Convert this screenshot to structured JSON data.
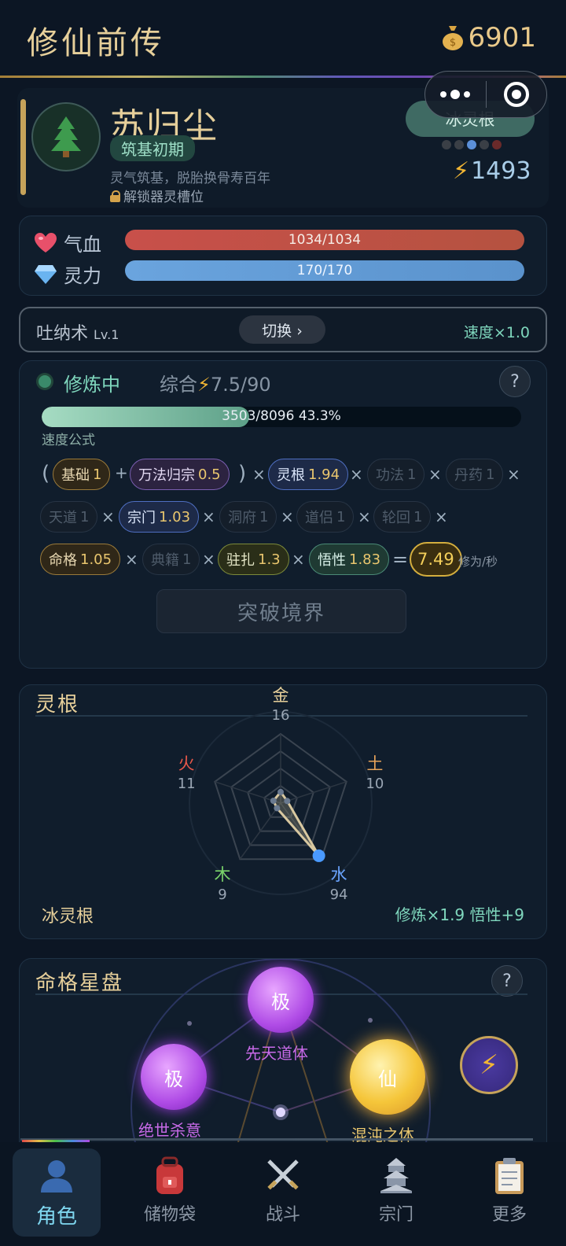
{
  "header": {
    "title": "修仙前传",
    "coin_icon": "money-bag-icon",
    "coins": "6901"
  },
  "character": {
    "avatar_icon": "tree-icon",
    "name": "苏归尘",
    "realm": "筑基初期",
    "description": "灵气筑基，脱胎换骨寿百年",
    "unlock_text": "解锁器灵槽位",
    "spirit_root_button": "冰灵根",
    "power": "1493",
    "dot_colors": [
      "#3a3f46",
      "#3a3f46",
      "#5b8fd8",
      "#3a3f46",
      "#6a2a2a"
    ]
  },
  "vitals": {
    "hp_label": "气血",
    "hp_value": "1034/1034",
    "hp_fraction": 1.0,
    "mp_label": "灵力",
    "mp_value": "170/170",
    "mp_fraction": 1.0
  },
  "technique": {
    "name": "吐纳术",
    "level": "Lv.1",
    "switch_label": "切换 ›",
    "speed": "速度×1.0"
  },
  "cultivation": {
    "status": "修炼中",
    "total_label": "综合",
    "total_value": "7.5/90",
    "help": "?",
    "progress_text": "3503/8096  43.3%",
    "progress_fraction": 0.433,
    "formula_label": "速度公式",
    "chips": [
      {
        "label": "基础",
        "value": "1"
      },
      {
        "label": "万法归宗",
        "value": "0.5"
      },
      {
        "label": "灵根",
        "value": "1.94"
      },
      {
        "label": "功法",
        "value": "1"
      },
      {
        "label": "丹药",
        "value": "1"
      },
      {
        "label": "天道",
        "value": "1"
      },
      {
        "label": "宗门",
        "value": "1.03"
      },
      {
        "label": "洞府",
        "value": "1"
      },
      {
        "label": "道侣",
        "value": "1"
      },
      {
        "label": "轮回",
        "value": "1"
      },
      {
        "label": "命格",
        "value": "1.05"
      },
      {
        "label": "典籍",
        "value": "1"
      },
      {
        "label": "驻扎",
        "value": "1.3"
      },
      {
        "label": "悟性",
        "value": "1.83"
      }
    ],
    "ops": {
      "open": "(",
      "close": ")",
      "plus": "+",
      "times": "×",
      "equals": "="
    },
    "result": "7.49",
    "result_unit": "修为/秒",
    "breakthrough_label": "突破境界"
  },
  "spirit_root": {
    "title": "灵根",
    "elements": [
      {
        "name": "金",
        "value": 16,
        "color": "#e6cf9a"
      },
      {
        "name": "土",
        "value": 10,
        "color": "#e6a35a"
      },
      {
        "name": "水",
        "value": 94,
        "color": "#6aa4ff"
      },
      {
        "name": "木",
        "value": 9,
        "color": "#7ad46a"
      },
      {
        "name": "火",
        "value": 11,
        "color": "#e8584a"
      }
    ],
    "root_name": "冰灵根",
    "bonus": "修炼×1.9  悟性+9"
  },
  "fate": {
    "title": "命格星盘",
    "help": "?",
    "orbs": [
      {
        "glyph": "极",
        "label": "先天道体"
      },
      {
        "glyph": "极",
        "label": "绝世杀意"
      },
      {
        "glyph": "仙",
        "label": "混沌之体"
      }
    ],
    "bolt_icon": "lightning-icon"
  },
  "nav": [
    {
      "icon": "person-icon",
      "label": "角色"
    },
    {
      "icon": "backpack-icon",
      "label": "储物袋"
    },
    {
      "icon": "crossed-swords-icon",
      "label": "战斗"
    },
    {
      "icon": "pagoda-icon",
      "label": "宗门"
    },
    {
      "icon": "clipboard-icon",
      "label": "更多"
    }
  ]
}
